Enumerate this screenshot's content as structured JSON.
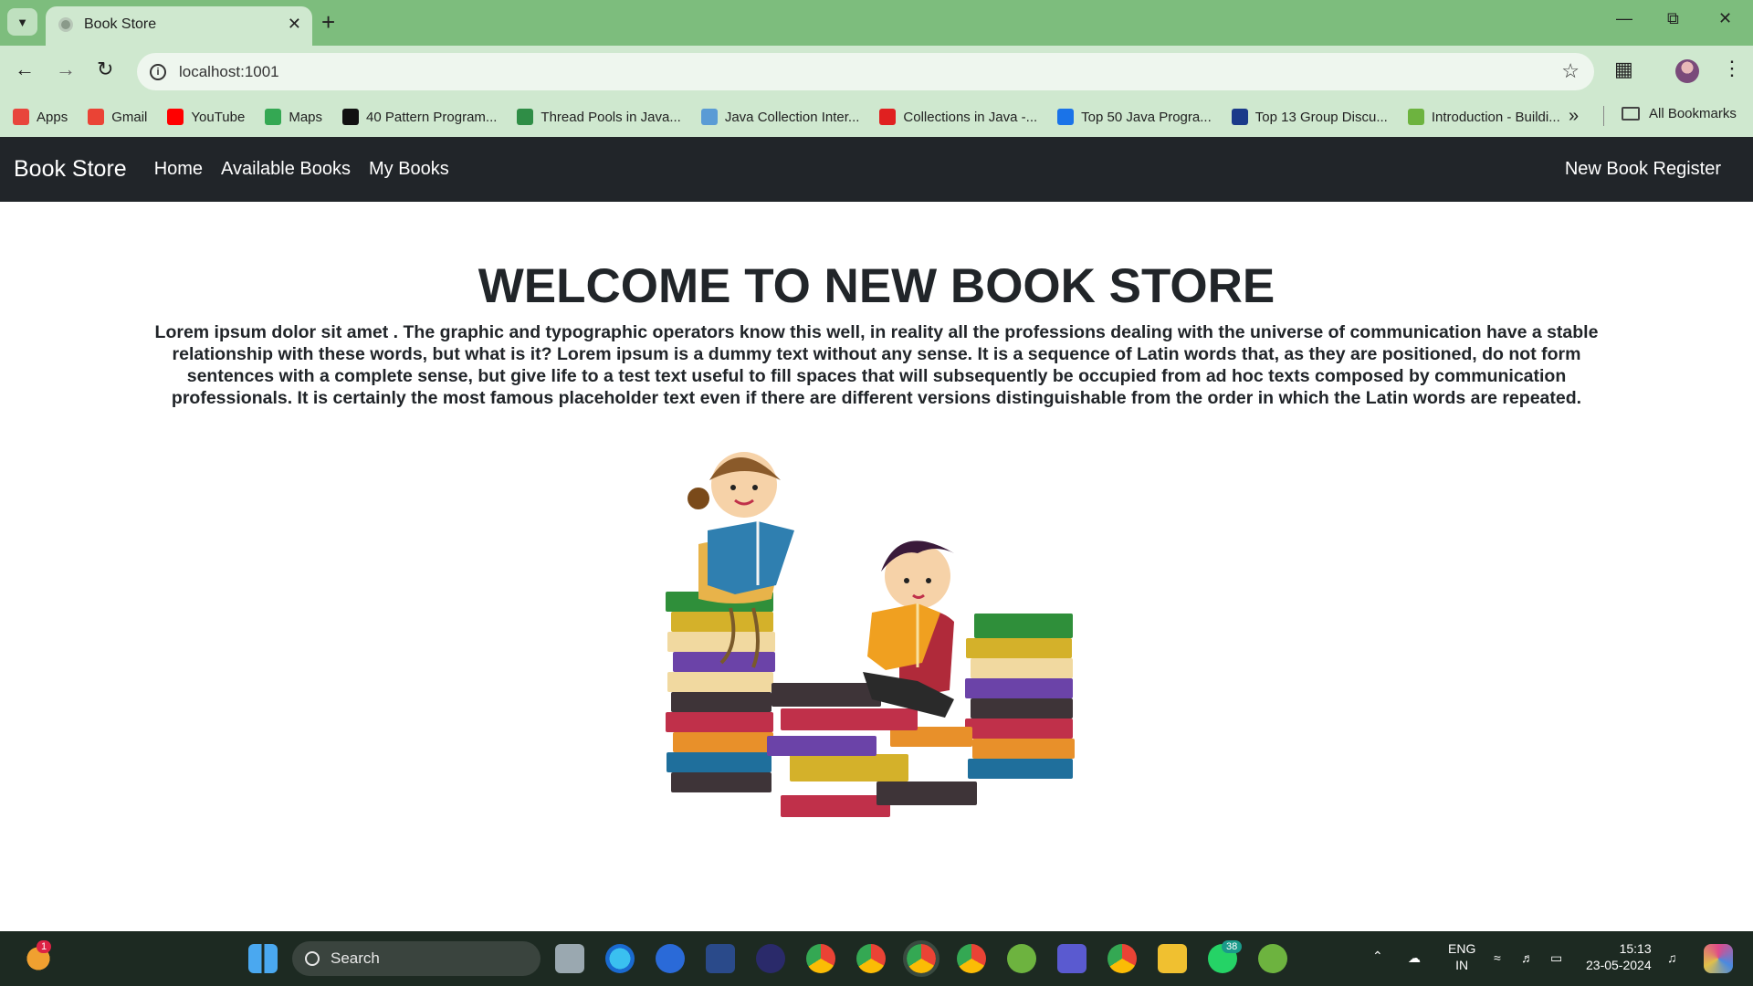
{
  "browser": {
    "tab_title": "Book Store",
    "url": "localhost:1001",
    "bookmarks": [
      {
        "label": "Apps",
        "icon": "apps-grid-icon",
        "color": "#e8453c"
      },
      {
        "label": "Gmail",
        "icon": "gmail-icon",
        "color": "#ea4335"
      },
      {
        "label": "YouTube",
        "icon": "youtube-icon",
        "color": "#ff0000"
      },
      {
        "label": "Maps",
        "icon": "maps-pin-icon",
        "color": "#34a853"
      },
      {
        "label": "40 Pattern Program...",
        "icon": "j-logo-icon",
        "color": "#111111"
      },
      {
        "label": "Thread Pools in Java...",
        "icon": "gfg-icon",
        "color": "#2f8d46"
      },
      {
        "label": "Java Collection Inter...",
        "icon": "javatpoint-icon",
        "color": "#5a9bd5"
      },
      {
        "label": "Collections in Java -...",
        "icon": "v-logo-icon",
        "color": "#e02020"
      },
      {
        "label": "Top 50 Java Progra...",
        "icon": "swirl-icon",
        "color": "#1a73e8"
      },
      {
        "label": "Top 13 Group Discu...",
        "icon": "slash-logo-icon",
        "color": "#1a3a8a"
      },
      {
        "label": "Introduction - Buildi...",
        "icon": "spring-leaf-icon",
        "color": "#6db33f"
      }
    ],
    "all_bookmarks": "All Bookmarks"
  },
  "navbar": {
    "brand": "Book Store",
    "links": [
      "Home",
      "Available Books",
      "My Books"
    ],
    "right_link": "New Book Register"
  },
  "main": {
    "heading": "WELCOME TO NEW BOOK STORE",
    "paragraph": "Lorem ipsum dolor sit amet . The graphic and typographic operators know this well, in reality all the professions dealing with the universe of communication have a stable relationship with these words, but what is it? Lorem ipsum is a dummy text without any sense. It is a sequence of Latin words that, as they are positioned, do not form sentences with a complete sense, but give life to a test text useful to fill spaces that will subsequently be occupied from ad hoc texts composed by communication professionals. It is certainly the most famous placeholder text even if there are different versions distinguishable from the order in which the Latin words are repeated."
  },
  "taskbar": {
    "search_placeholder": "Search",
    "notification_count": "1",
    "whatsapp_badge": "38",
    "language_line1": "ENG",
    "language_line2": "IN",
    "time": "15:13",
    "date": "23-05-2024"
  },
  "colors": {
    "tabstrip": "#7dbd7d",
    "toolbar": "#cfe8cf",
    "navbar": "#212529",
    "taskbar": "#1d2a22"
  }
}
